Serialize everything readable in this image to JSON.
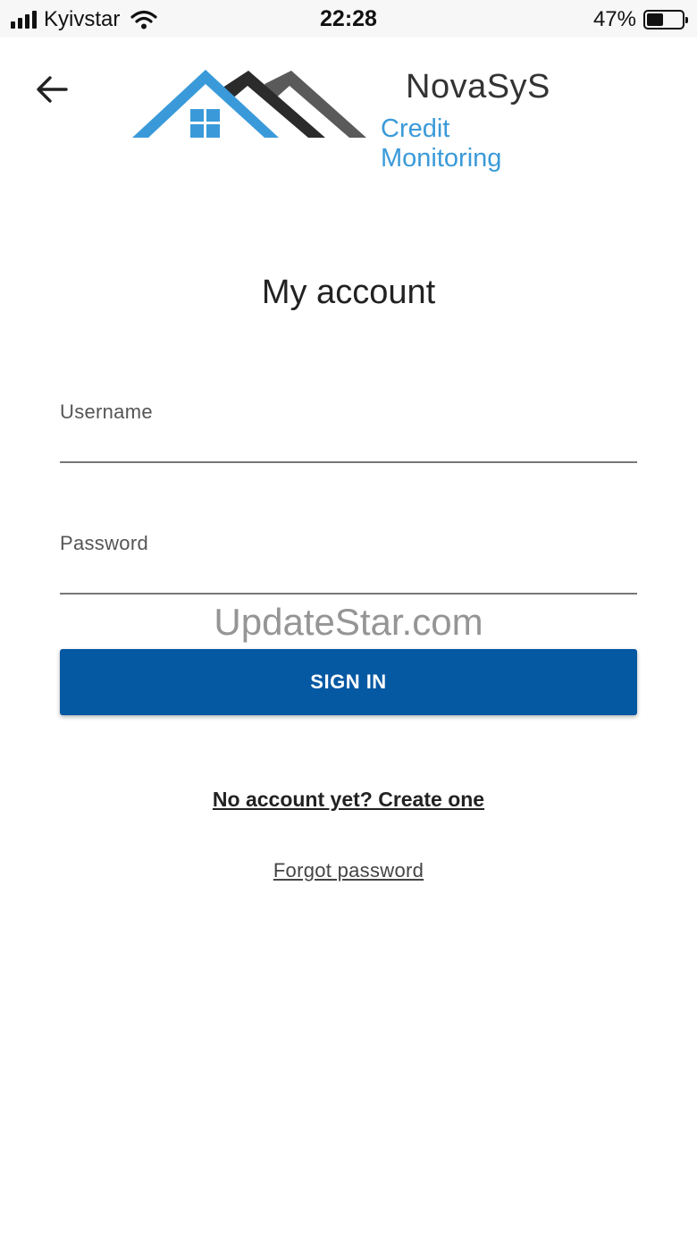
{
  "status_bar": {
    "carrier": "Kyivstar",
    "time": "22:28",
    "battery_percent": "47%",
    "battery_level": 0.47,
    "signal_bars": 4,
    "icons": [
      "signal-icon",
      "wifi-icon",
      "battery-icon"
    ]
  },
  "header": {
    "back_icon": "arrow-left-icon",
    "brand_name": "NovaSyS",
    "brand_tagline": "Credit Monitoring"
  },
  "main": {
    "title": "My account",
    "username_label": "Username",
    "username_value": "",
    "password_label": "Password",
    "password_value": "",
    "sign_in_label": "SIGN IN",
    "create_account_link": "No account yet? Create one",
    "forgot_password_link": "Forgot password"
  },
  "watermark": "UpdateStar.com",
  "colors": {
    "primary_button": "#0558a2",
    "brand_blue": "#3a9ad9",
    "roof_dark": "#2b2b2b",
    "roof_gray": "#555555"
  }
}
